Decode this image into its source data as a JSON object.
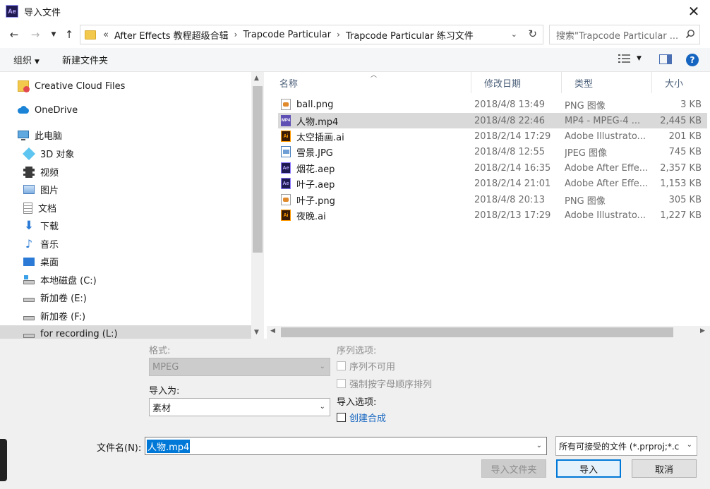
{
  "window": {
    "app_icon": "Ae",
    "title": "导入文件"
  },
  "address": {
    "crumbs": [
      "After Effects 教程超级合辑",
      "Trapcode Particular",
      "Trapcode Particular 练习文件"
    ],
    "overflow": "«"
  },
  "search": {
    "placeholder": "搜索\"Trapcode Particular ..."
  },
  "toolbar": {
    "organize": "组织",
    "new_folder": "新建文件夹",
    "help": "?"
  },
  "nav": {
    "items": [
      {
        "label": "Creative Cloud Files",
        "icon": "creative-cloud-icon"
      },
      {
        "label": "OneDrive",
        "icon": "onedrive-icon"
      },
      {
        "label": "此电脑",
        "icon": "this-pc-icon"
      },
      {
        "label": "3D 对象",
        "icon": "3d-objects-icon"
      },
      {
        "label": "视频",
        "icon": "videos-icon"
      },
      {
        "label": "图片",
        "icon": "pictures-icon"
      },
      {
        "label": "文档",
        "icon": "documents-icon"
      },
      {
        "label": "下载",
        "icon": "downloads-icon"
      },
      {
        "label": "音乐",
        "icon": "music-icon"
      },
      {
        "label": "桌面",
        "icon": "desktop-icon"
      },
      {
        "label": "本地磁盘 (C:)",
        "icon": "local-disk-icon"
      },
      {
        "label": "新加卷 (E:)",
        "icon": "drive-icon"
      },
      {
        "label": "新加卷 (F:)",
        "icon": "drive-icon"
      },
      {
        "label": "for recording (L:)",
        "icon": "drive-icon"
      }
    ]
  },
  "columns": {
    "name": "名称",
    "date": "修改日期",
    "type": "类型",
    "size": "大小"
  },
  "files": [
    {
      "name": "ball.png",
      "date": "2018/4/8 13:49",
      "type": "PNG 图像",
      "size": "3 KB",
      "kind": "png",
      "badge": ""
    },
    {
      "name": "人物.mp4",
      "date": "2018/4/8 22:46",
      "type": "MP4 - MPEG-4 ...",
      "size": "2,445 KB",
      "kind": "mp4",
      "badge": "MP4",
      "selected": true
    },
    {
      "name": "太空插画.ai",
      "date": "2018/2/14 17:29",
      "type": "Adobe Illustrato...",
      "size": "201 KB",
      "kind": "ai",
      "badge": "Ai"
    },
    {
      "name": "雪景.JPG",
      "date": "2018/4/8 12:55",
      "type": "JPEG 图像",
      "size": "745 KB",
      "kind": "jpg",
      "badge": ""
    },
    {
      "name": "烟花.aep",
      "date": "2018/2/14 16:35",
      "type": "Adobe After Effe...",
      "size": "2,357 KB",
      "kind": "aep",
      "badge": "Ae"
    },
    {
      "name": "叶子.aep",
      "date": "2018/2/14 21:01",
      "type": "Adobe After Effe...",
      "size": "1,153 KB",
      "kind": "aep",
      "badge": "Ae"
    },
    {
      "name": "叶子.png",
      "date": "2018/4/8 20:13",
      "type": "PNG 图像",
      "size": "305 KB",
      "kind": "png",
      "badge": ""
    },
    {
      "name": "夜晚.ai",
      "date": "2018/2/13 17:29",
      "type": "Adobe Illustrato...",
      "size": "1,227 KB",
      "kind": "ai",
      "badge": "Ai"
    }
  ],
  "options": {
    "format_label": "格式:",
    "format_value": "MPEG",
    "import_as_label": "导入为:",
    "import_as_value": "素材",
    "sequence_label": "序列选项:",
    "sequence_unavailable": "序列不可用",
    "force_alpha": "强制按字母顺序排列",
    "import_options_label": "导入选项:",
    "create_comp": "创建合成"
  },
  "footer": {
    "filename_label": "文件名(N):",
    "filename_value": "人物.mp4",
    "filter_value": "所有可接受的文件 (*.prproj;*.c",
    "import_folder": "导入文件夹",
    "import": "导入",
    "cancel": "取消"
  },
  "colors": {
    "accent": "#0078d7",
    "selection": "#d9d9d9",
    "panel": "#f0f0f0"
  }
}
